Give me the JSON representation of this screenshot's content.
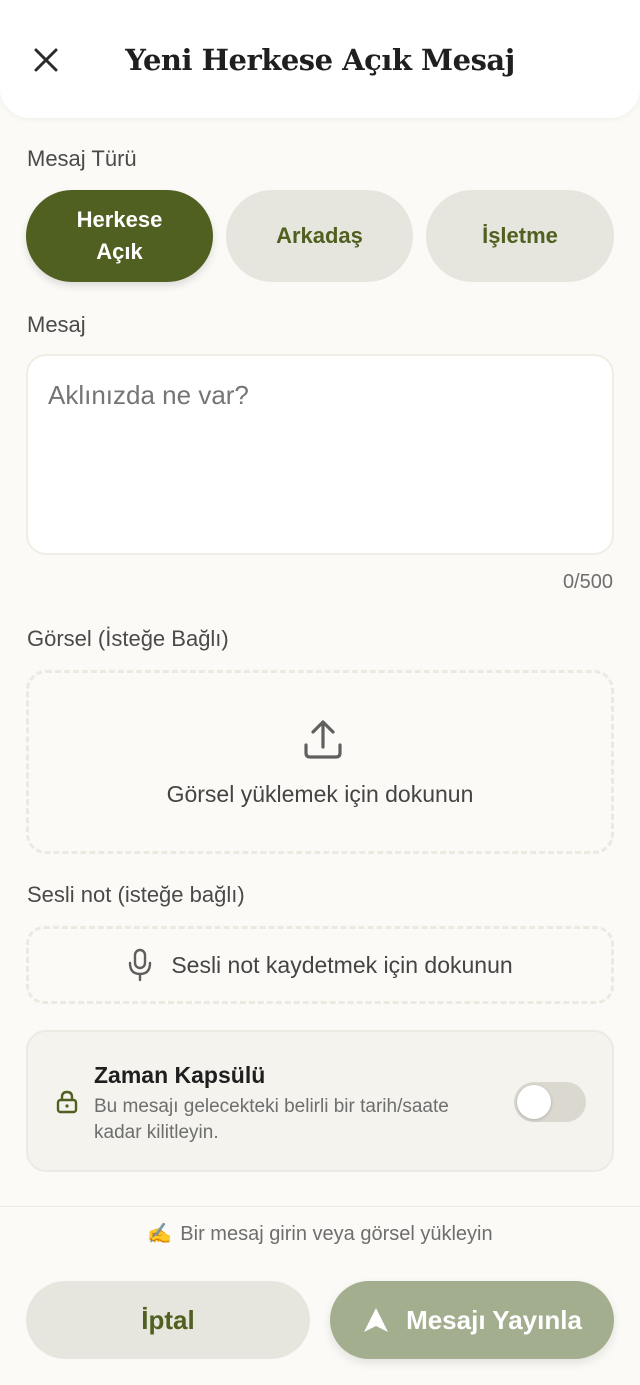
{
  "header": {
    "title": "Yeni Herkese Açık Mesaj"
  },
  "type_section": {
    "label": "Mesaj Türü",
    "options": [
      {
        "label_line1": "Herkese",
        "label_line2": "Açık",
        "active": true
      },
      {
        "label": "Arkadaş",
        "active": false
      },
      {
        "label": "İşletme",
        "active": false
      }
    ]
  },
  "message": {
    "label": "Mesaj",
    "placeholder": "Aklınızda ne var?",
    "value": "",
    "counter": "0/500"
  },
  "image": {
    "label": "Görsel (İsteğe Bağlı)",
    "upload_text": "Görsel yüklemek için dokunun",
    "icon": "upload-icon"
  },
  "voice": {
    "label": "Sesli not (isteğe bağlı)",
    "record_text": "Sesli not kaydetmek için dokunun",
    "icon": "microphone-icon"
  },
  "time_capsule": {
    "title": "Zaman Kapsülü",
    "description": "Bu mesajı gelecekteki belirli bir tarih/saate kadar kilitleyin.",
    "enabled": false,
    "icon": "lock-icon"
  },
  "footer": {
    "hint_emoji": "✍️",
    "hint": "Bir mesaj girin veya görsel yükleyin",
    "cancel_label": "İptal",
    "publish_label": "Mesajı Yayınla",
    "publish_icon": "send-arrow-icon"
  },
  "colors": {
    "accent": "#4f6020",
    "chip_inactive": "#e7e6de",
    "publish_disabled": "#a2ae8e",
    "background": "#fbfaf6"
  }
}
